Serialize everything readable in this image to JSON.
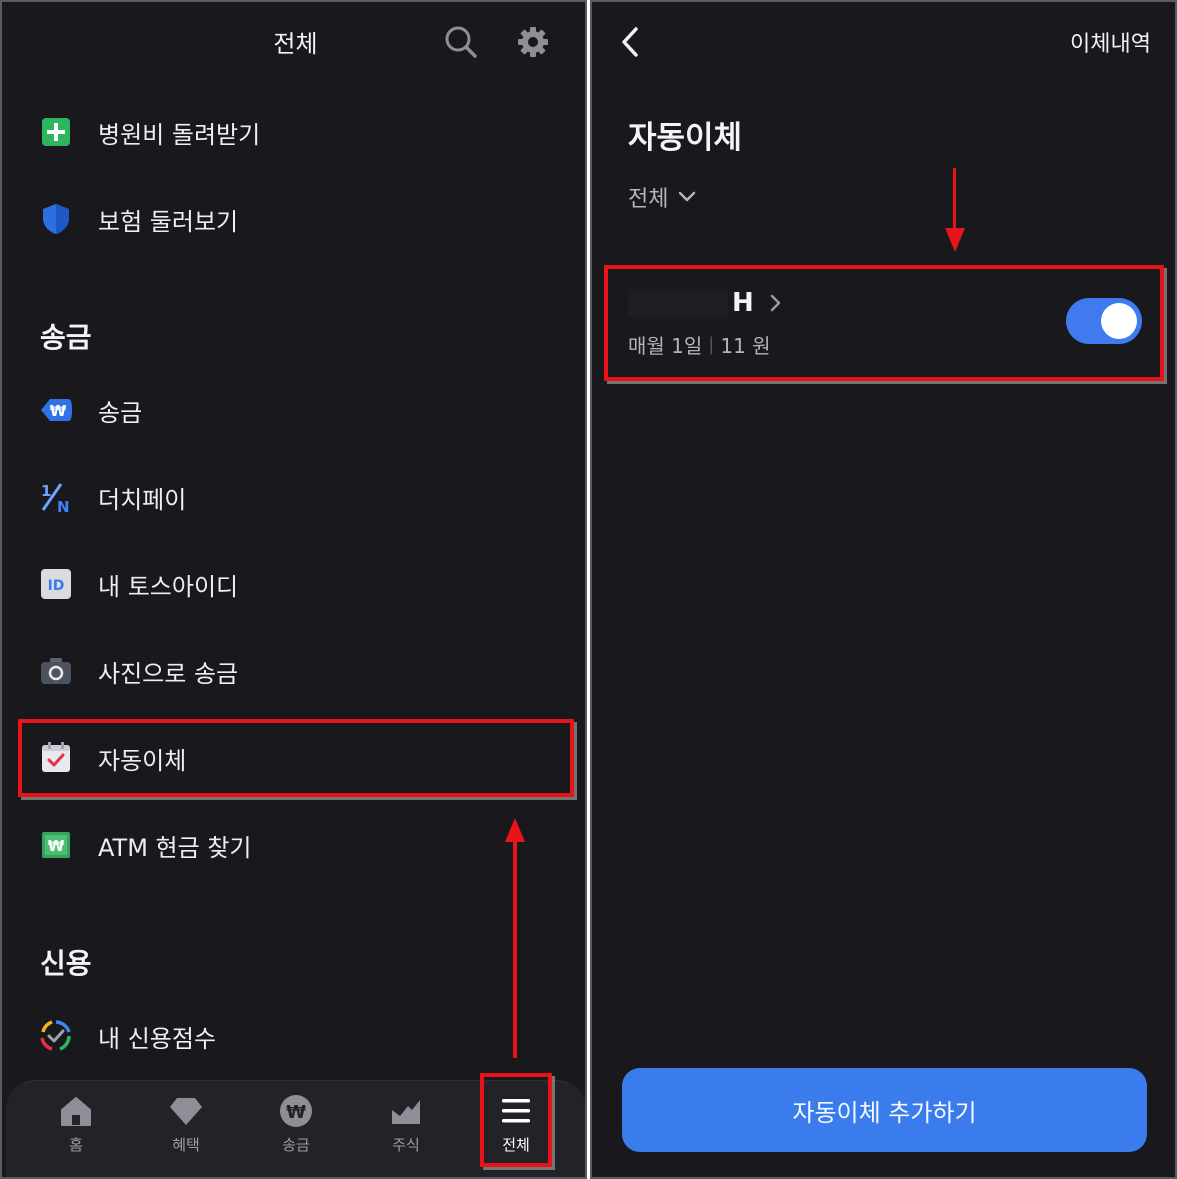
{
  "left": {
    "header": {
      "title": "전체"
    },
    "items_top": [
      {
        "label": "병원비 돌려받기",
        "icon": "plus-square-icon"
      },
      {
        "label": "보험 둘러보기",
        "icon": "shield-icon"
      }
    ],
    "section_remit": {
      "title": "송금"
    },
    "remit_items": [
      {
        "label": "송금",
        "icon": "won-badge-icon"
      },
      {
        "label": "더치페이",
        "icon": "dutch-pay-icon"
      },
      {
        "label": "내 토스아이디",
        "icon": "id-card-icon"
      },
      {
        "label": "사진으로 송금",
        "icon": "camera-icon"
      },
      {
        "label": "자동이체",
        "icon": "calendar-check-icon"
      },
      {
        "label": "ATM 현금 찾기",
        "icon": "atm-cash-icon"
      }
    ],
    "section_credit": {
      "title": "신용"
    },
    "credit_items": [
      {
        "label": "내 신용점수",
        "icon": "credit-gauge-icon"
      }
    ],
    "tabbar": [
      {
        "label": "홈",
        "icon": "home-icon"
      },
      {
        "label": "혜택",
        "icon": "gem-icon"
      },
      {
        "label": "송금",
        "icon": "won-coin-icon"
      },
      {
        "label": "주식",
        "icon": "chart-icon"
      },
      {
        "label": "전체",
        "icon": "menu-icon",
        "active": true
      }
    ]
  },
  "right": {
    "header": {
      "history_label": "이체내역"
    },
    "title": "자동이체",
    "filter": {
      "label": "전체"
    },
    "transfer": {
      "name": "H",
      "schedule": "매월 1일",
      "amount": "11 원",
      "enabled": true
    },
    "add_button": "자동이체 추가하기"
  },
  "colors": {
    "background": "#18181d",
    "accent": "#3b7cec",
    "highlight": "#e8141a"
  }
}
